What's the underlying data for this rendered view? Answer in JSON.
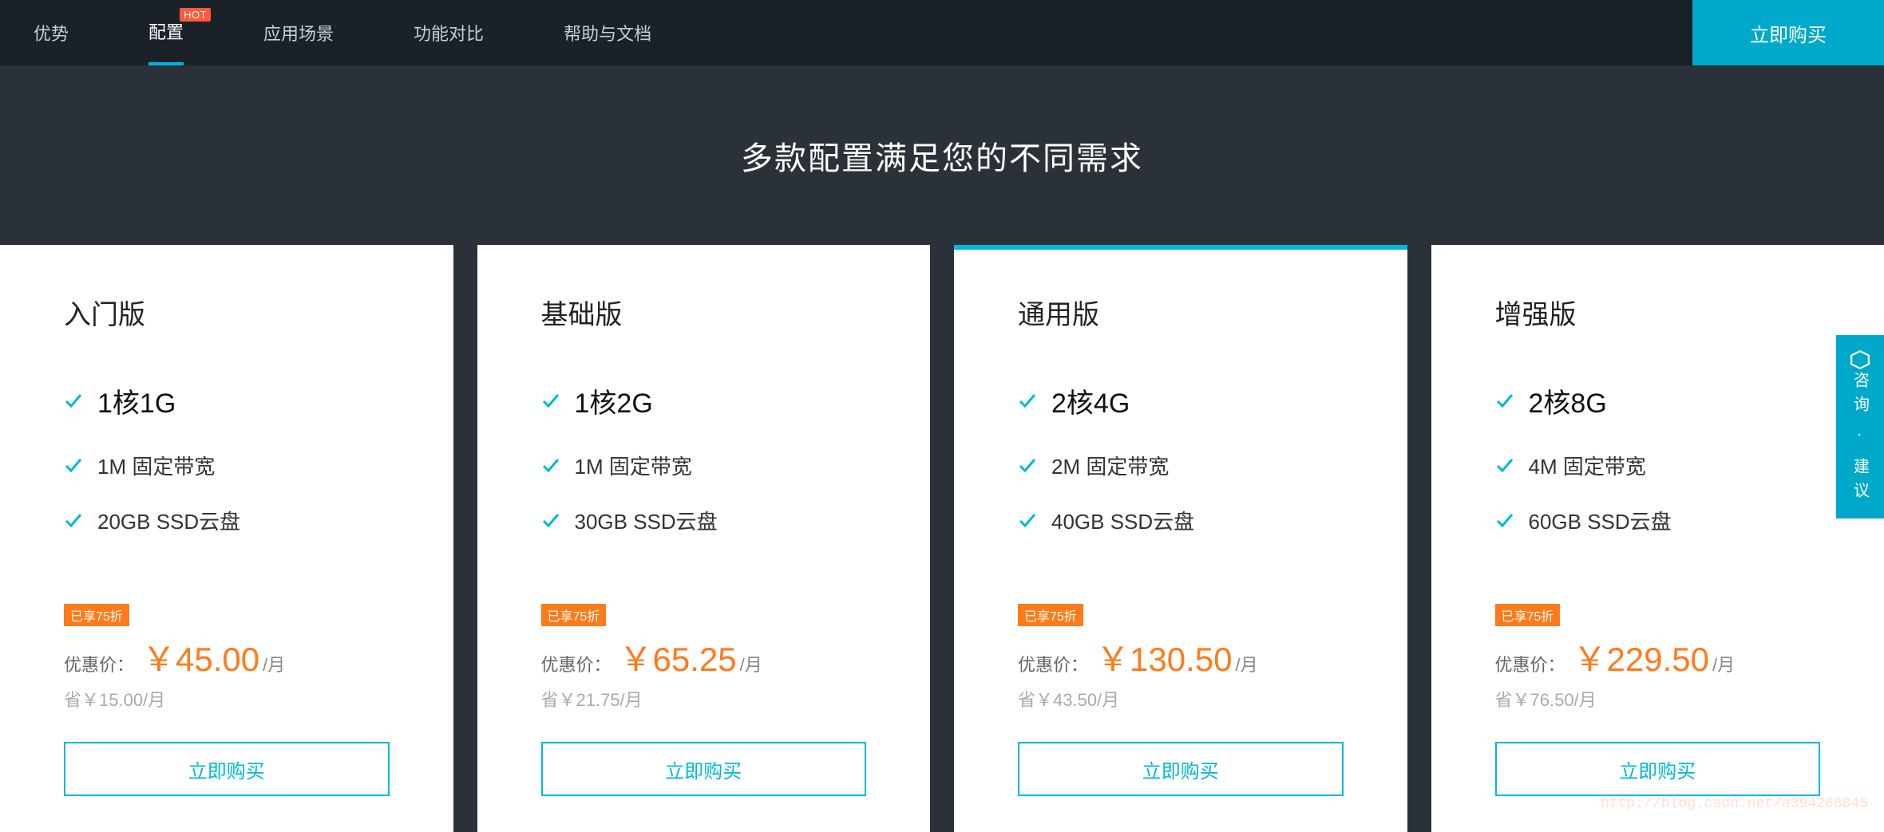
{
  "nav": {
    "items": [
      {
        "label": "优势",
        "active": false,
        "hot": false
      },
      {
        "label": "配置",
        "active": true,
        "hot": true
      },
      {
        "label": "应用场景",
        "active": false,
        "hot": false
      },
      {
        "label": "功能对比",
        "active": false,
        "hot": false
      },
      {
        "label": "帮助与文档",
        "active": false,
        "hot": false
      }
    ],
    "hot_badge": "HOT",
    "buy_now": "立即购买"
  },
  "hero": {
    "title": "多款配置满足您的不同需求"
  },
  "discount_tag": "已享75折",
  "price_label": "优惠价：",
  "price_unit": "/月",
  "buy_button": "立即购买",
  "plans": [
    {
      "name": "入门版",
      "highlight": false,
      "spec": "1核1G",
      "bandwidth": "1M 固定带宽",
      "storage": "20GB SSD云盘",
      "price": "￥45.00",
      "save": "省￥15.00/月"
    },
    {
      "name": "基础版",
      "highlight": false,
      "spec": "1核2G",
      "bandwidth": "1M 固定带宽",
      "storage": "30GB SSD云盘",
      "price": "￥65.25",
      "save": "省￥21.75/月"
    },
    {
      "name": "通用版",
      "highlight": true,
      "spec": "2核4G",
      "bandwidth": "2M 固定带宽",
      "storage": "40GB SSD云盘",
      "price": "￥130.50",
      "save": "省￥43.50/月"
    },
    {
      "name": "增强版",
      "highlight": false,
      "spec": "2核8G",
      "bandwidth": "4M 固定带宽",
      "storage": "60GB SSD云盘",
      "price": "￥229.50",
      "save": "省￥76.50/月"
    }
  ],
  "feedback": {
    "label": "咨询 · 建议"
  },
  "watermark": "http://blog.csdn.net/a394268045"
}
